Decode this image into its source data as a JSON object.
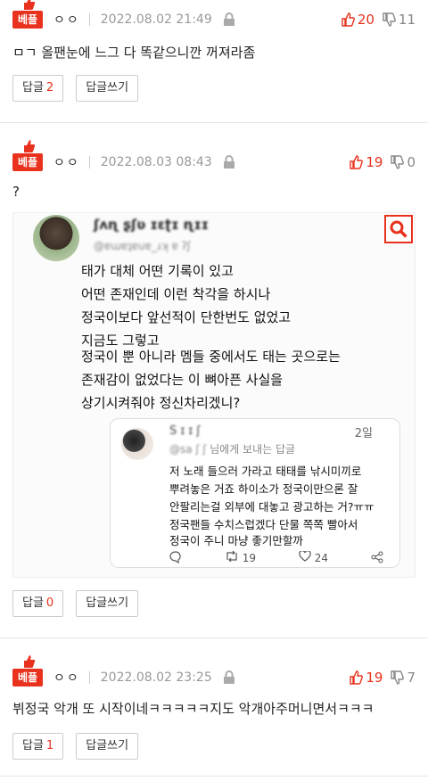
{
  "colors": {
    "accent": "#e8321e",
    "muted": "#999999",
    "border": "#cccccc"
  },
  "comments": [
    {
      "badge": "베플",
      "nick": "ㅇㅇ",
      "date": "2022.08.02 21:49",
      "up": "20",
      "down": "11",
      "text": "ㅁㄱ 올팬눈에 느그 다 똑같으니깐 꺼져라좀",
      "reply_label": "답글",
      "reply_count": "2",
      "write_label": "답글쓰기"
    },
    {
      "badge": "베플",
      "nick": "ㅇㅇ",
      "date": "2022.08.03 08:43",
      "up": "19",
      "down": "0",
      "text": "?",
      "reply_label": "답글",
      "reply_count": "0",
      "write_label": "답글쓰기",
      "embed": {
        "tweet_lines": [
          "태가 대체 어떤 기록이 있고",
          "어떤 존재인데 이런 착각을 하시나",
          "정국이보다 앞선적이 단한번도 없었고",
          "지금도 그렇고",
          "정국이 뿐 아니라 멤들 중에서도 태는 곳으로는",
          "존재감이 없었다는 이 뼈아픈 사실을",
          "상기시켜줘야 정신차리겠니?"
        ],
        "reply": {
          "date": "2일",
          "to": "님에게 보내는 답글",
          "lines": [
            "저 노래 들으러 가라고 태태를 낚시미끼로",
            "뿌려놓은 거죠 하이소가 정국이만으론 잘",
            "안팔리는걸 외부에 대놓고 광고하는 거?ㅠㅠ",
            "정국팬들 수치스럽겠다 단물 쪽쪽 빨아서",
            "정국이 주니 마냥 좋기만할까"
          ],
          "retweets": "19",
          "likes": "24"
        }
      }
    },
    {
      "badge": "베플",
      "nick": "ㅇㅇ",
      "date": "2022.08.02 23:25",
      "up": "19",
      "down": "7",
      "text": "뷔정국 악개 또 시작이네ㅋㅋㅋㅋㅋ지도 악개아주머니면서ㅋㅋㅋ",
      "reply_label": "답글",
      "reply_count": "1",
      "write_label": "답글쓰기"
    }
  ]
}
